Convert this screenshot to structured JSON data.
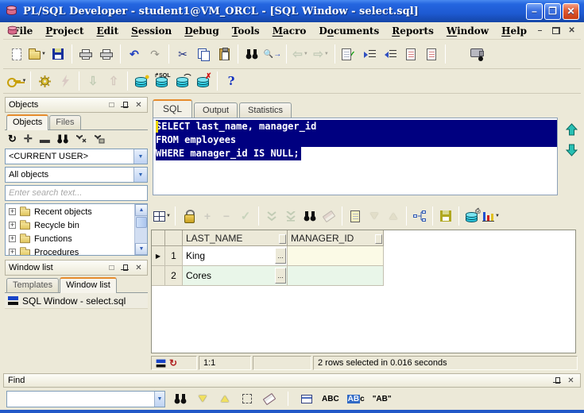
{
  "titlebar": {
    "title": "PL/SQL Developer - student1@VM_ORCL - [SQL Window - select.sql]"
  },
  "menubar": {
    "items": [
      {
        "pre": "",
        "u": "F",
        "post": "ile"
      },
      {
        "pre": "",
        "u": "P",
        "post": "roject"
      },
      {
        "pre": "",
        "u": "E",
        "post": "dit"
      },
      {
        "pre": "",
        "u": "S",
        "post": "ession"
      },
      {
        "pre": "",
        "u": "D",
        "post": "ebug"
      },
      {
        "pre": "",
        "u": "T",
        "post": "ools"
      },
      {
        "pre": "",
        "u": "M",
        "post": "acro"
      },
      {
        "pre": "D",
        "u": "o",
        "post": "cuments"
      },
      {
        "pre": "",
        "u": "R",
        "post": "eports"
      },
      {
        "pre": "",
        "u": "W",
        "post": "indow"
      },
      {
        "pre": "",
        "u": "H",
        "post": "elp"
      }
    ]
  },
  "toolbars": {
    "standard_icons": [
      "new-document",
      "open-file",
      "save-file",
      "print",
      "print-setup",
      "undo",
      "redo",
      "cut",
      "copy",
      "paste",
      "find",
      "find-next",
      "navigate-back",
      "navigate-forward",
      "syntax-check",
      "indent",
      "unindent",
      "doc-to-end",
      "doc-to-begin",
      "record-macro"
    ],
    "session_icons": [
      "log-on",
      "preferences",
      "break",
      "import",
      "export",
      "test-window",
      "new-sql-window",
      "find-database-objects",
      "rollback",
      "help"
    ],
    "help_label": "?"
  },
  "objects_panel": {
    "title": "Objects",
    "tabs": [
      "Objects",
      "Files"
    ],
    "toolbar_icons": [
      "refresh",
      "expand",
      "collapse",
      "find-object",
      "filter",
      "filter-settings"
    ],
    "user_select_value": "<CURRENT USER>",
    "object_filter_value": "All objects",
    "search_placeholder": "Enter search text...",
    "tree_items": [
      "Recent objects",
      "Recycle bin",
      "Functions",
      "Procedures"
    ]
  },
  "window_list_panel": {
    "title": "Window list",
    "tabs": [
      "Templates",
      "Window list"
    ],
    "items": [
      "SQL Window - select.sql"
    ]
  },
  "workspace": {
    "tabs": [
      "SQL",
      "Output",
      "Statistics"
    ],
    "editor": {
      "lines": [
        "SELECT last_name, manager_id",
        "FROM employees",
        "WHERE manager_id IS NULL;"
      ]
    },
    "results_toolbar_icons": [
      "grid-layout",
      "lock",
      "insert-row",
      "delete-row",
      "post-changes",
      "fetch-next",
      "fetch-all",
      "find-in-grid",
      "edit-data",
      "copy-to-excel",
      "sort-descending",
      "sort-ascending",
      "single-record-view",
      "save-results",
      "print-results",
      "chart"
    ],
    "results": {
      "columns": [
        "LAST_NAME",
        "MANAGER_ID"
      ],
      "rows": [
        {
          "num": "1",
          "last_name": "King",
          "manager_id": ""
        },
        {
          "num": "2",
          "last_name": "Cores",
          "manager_id": ""
        }
      ]
    },
    "statusbar": {
      "cursor_position": "1:1",
      "message": "2 rows selected in 0.016 seconds"
    }
  },
  "find_panel": {
    "title": "Find",
    "input_value": "",
    "icons": [
      "find",
      "find-next-down",
      "find-previous-up",
      "select-region",
      "clear",
      "cell-mode",
      "case-insensitive",
      "case-sensitive",
      "whole-word"
    ],
    "labels": {
      "abc": "ABC",
      "match_hl": "AB",
      "match_tail": "c",
      "whole_word": "\"AB\""
    }
  },
  "colors": {
    "title_blue": "#1e5ad2",
    "window_border": "#2258c8",
    "background_beige": "#ece9d8",
    "selection_navy": "#000080",
    "active_tab_orange": "#e68b2c",
    "db_icon_teal": "#2cc6dc",
    "row1_manager_bg": "#fbfae6",
    "row2_bg": "#e9f6e9"
  }
}
